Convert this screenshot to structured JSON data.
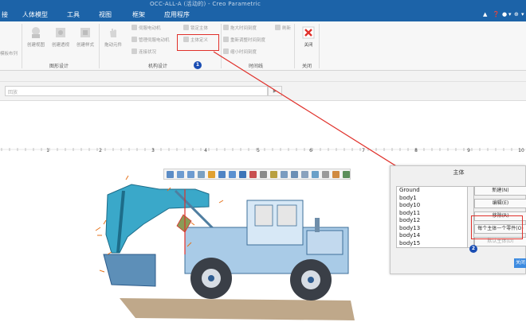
{
  "window": {
    "title": "OCC-ALL-A (活动的) - Creo Parametric"
  },
  "menubar": {
    "items": [
      {
        "label": "接"
      },
      {
        "label": "人体模型"
      },
      {
        "label": "工具"
      },
      {
        "label": "视图"
      },
      {
        "label": "框架"
      },
      {
        "label": "应用程序"
      }
    ],
    "controls": [
      "▲",
      "❓",
      "●",
      "▾",
      "⊕",
      "▾"
    ]
  },
  "ribbon": {
    "left_cut_label": "模板布列",
    "view_buttons": [
      "创建视图",
      "创建透视",
      "创建样式"
    ],
    "group_design": "图形设计",
    "extra_button": "拖动元件",
    "mech_items": [
      "伺服电动机",
      "管理伺服电动机",
      "连接状况"
    ],
    "mech_items2": [
      "锁定主体",
      "主体定义"
    ],
    "group_mech": "机构设计",
    "time_items": [
      "拖大时间刻度",
      "重新调整时间刻度",
      "缩小时间刻度"
    ],
    "time_items2": [
      "刷新"
    ],
    "group_time": "时间线",
    "close_label": "关闭",
    "group_close": "关闭"
  },
  "band2": {
    "field_text": "回放",
    "play": "▶"
  },
  "ruler": {
    "ticks": [
      "1",
      "2",
      "3",
      "4",
      "5",
      "6",
      "7",
      "8",
      "9",
      "10"
    ]
  },
  "annotations": {
    "badge1": "1",
    "badge2": "2"
  },
  "dialog": {
    "title": "主体",
    "bodies": [
      "Ground",
      "body1",
      "body10",
      "body11",
      "body12",
      "body13",
      "body14",
      "body15"
    ],
    "buttons": {
      "new": "新建(N)",
      "edit": "编辑(E)",
      "remove": "移除(R)",
      "one_per_part": "每个主体一个零件(O)",
      "default_body": "默认主体(D)"
    },
    "close": "关闭"
  },
  "colors": {
    "accent": "#1c63a8",
    "highlight": "#e0302a",
    "excavator": "#3aa8c9"
  }
}
